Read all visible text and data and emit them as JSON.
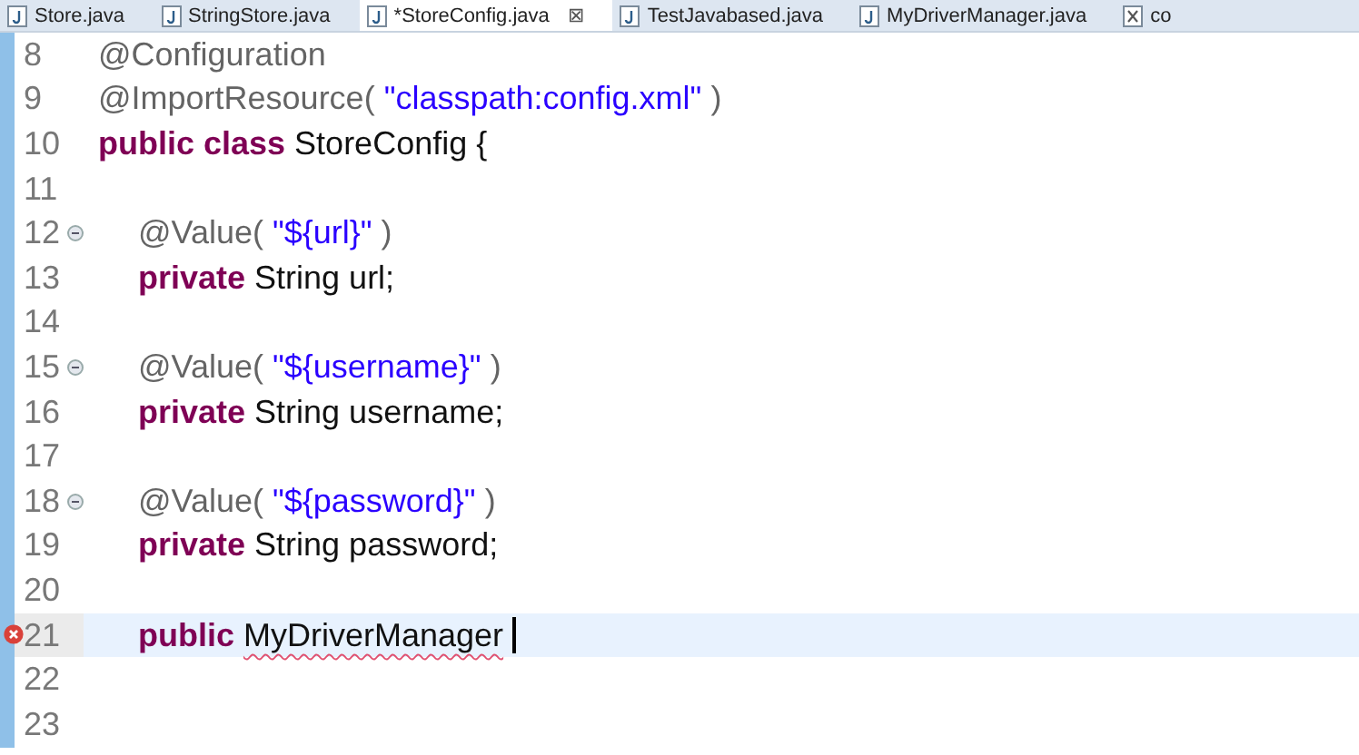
{
  "tabs": [
    {
      "label": "Store.java",
      "selected": false,
      "kind": "java"
    },
    {
      "label": "StringStore.java",
      "selected": false,
      "kind": "java"
    },
    {
      "label": "*StoreConfig.java",
      "selected": true,
      "kind": "java",
      "close": "⊠"
    },
    {
      "label": "TestJavabased.java",
      "selected": false,
      "kind": "java"
    },
    {
      "label": "MyDriverManager.java",
      "selected": false,
      "kind": "java"
    },
    {
      "label": "co",
      "selected": false,
      "kind": "xml"
    }
  ],
  "lines": [
    {
      "number": "8",
      "indented": false,
      "fold": false,
      "error": false,
      "current": false,
      "tokens": [
        {
          "kind": "annotation",
          "text": "@Configuration"
        }
      ]
    },
    {
      "number": "9",
      "indented": false,
      "fold": false,
      "error": false,
      "current": false,
      "tokens": [
        {
          "kind": "annotation",
          "text": "@ImportResource("
        },
        {
          "kind": "string",
          "text": "\"classpath:config.xml\""
        },
        {
          "kind": "annotation",
          "text": ")"
        }
      ]
    },
    {
      "number": "10",
      "indented": false,
      "fold": false,
      "error": false,
      "current": false,
      "tokens": [
        {
          "kind": "keyword",
          "text": "public class"
        },
        {
          "kind": "plain",
          "text": "StoreConfig {"
        }
      ]
    },
    {
      "number": "11",
      "fold": false,
      "error": false,
      "current": false
    },
    {
      "number": "12",
      "indented": true,
      "fold": true,
      "error": false,
      "current": false,
      "tokens": [
        {
          "kind": "annotation",
          "text": "@Value("
        },
        {
          "kind": "string",
          "text": "\"${url}\""
        },
        {
          "kind": "annotation",
          "text": ")"
        }
      ]
    },
    {
      "number": "13",
      "indented": true,
      "fold": false,
      "error": false,
      "current": false,
      "tokens": [
        {
          "kind": "keyword",
          "text": "private"
        },
        {
          "kind": "plain",
          "text": "String url;"
        }
      ]
    },
    {
      "number": "14",
      "fold": false,
      "error": false,
      "current": false
    },
    {
      "number": "15",
      "indented": true,
      "fold": true,
      "error": false,
      "current": false,
      "tokens": [
        {
          "kind": "annotation",
          "text": "@Value("
        },
        {
          "kind": "string",
          "text": "\"${username}\""
        },
        {
          "kind": "annotation",
          "text": ")"
        }
      ]
    },
    {
      "number": "16",
      "indented": true,
      "fold": false,
      "error": false,
      "current": false,
      "tokens": [
        {
          "kind": "keyword",
          "text": "private"
        },
        {
          "kind": "plain",
          "text": "String username;"
        }
      ]
    },
    {
      "number": "17",
      "fold": false,
      "error": false,
      "current": false
    },
    {
      "number": "18",
      "indented": true,
      "fold": true,
      "error": false,
      "current": false,
      "tokens": [
        {
          "kind": "annotation",
          "text": "@Value("
        },
        {
          "kind": "string",
          "text": "\"${password}\""
        },
        {
          "kind": "annotation",
          "text": ")"
        }
      ]
    },
    {
      "number": "19",
      "indented": true,
      "fold": false,
      "error": false,
      "current": false,
      "tokens": [
        {
          "kind": "keyword",
          "text": "private"
        },
        {
          "kind": "plain",
          "text": "String password;"
        }
      ]
    },
    {
      "number": "20",
      "fold": false,
      "error": false,
      "current": false
    },
    {
      "number": "21",
      "indented": true,
      "fold": false,
      "error": true,
      "current": true,
      "tokens": [
        {
          "kind": "keyword",
          "text": "public"
        },
        {
          "kind": "unresolved",
          "text": "MyDriverManager"
        }
      ]
    },
    {
      "number": "22",
      "fold": false,
      "error": false,
      "current": false
    },
    {
      "number": "23",
      "fold": false,
      "error": false,
      "current": false
    }
  ]
}
